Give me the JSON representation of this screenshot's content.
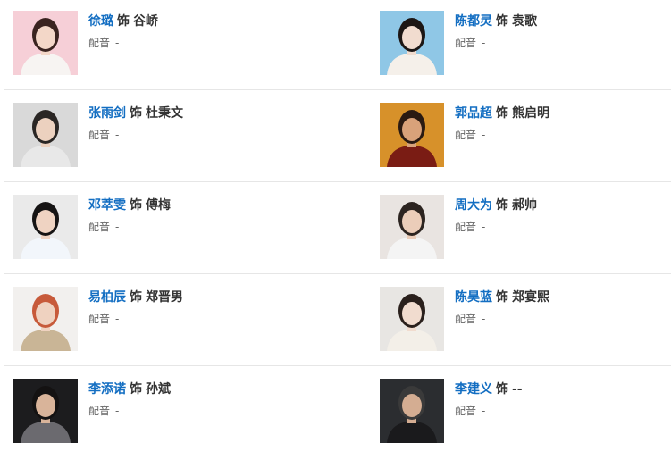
{
  "cast": [
    {
      "actor": "徐璐",
      "as_word": "饰",
      "role": "谷峤",
      "dub_label": "配音",
      "dub_value": "-",
      "photo": {
        "bg": "#f6cfd7",
        "hair": "#3a2420",
        "skin": "#f3d7c8",
        "cloth": "#f7f4f2"
      }
    },
    {
      "actor": "陈都灵",
      "as_word": "饰",
      "role": "袁歌",
      "dub_label": "配音",
      "dub_value": "-",
      "photo": {
        "bg": "#8fc7e6",
        "hair": "#1c1614",
        "skin": "#f1dccf",
        "cloth": "#f5f0ea"
      }
    },
    {
      "actor": "张雨剑",
      "as_word": "饰",
      "role": "杜秉文",
      "dub_label": "配音",
      "dub_value": "-",
      "photo": {
        "bg": "#d9d9d9",
        "hair": "#2a2624",
        "skin": "#ecd1bf",
        "cloth": "#e8e8e8"
      }
    },
    {
      "actor": "郭品超",
      "as_word": "饰",
      "role": "熊启明",
      "dub_label": "配音",
      "dub_value": "-",
      "photo": {
        "bg": "#d7912a",
        "hair": "#2a1a12",
        "skin": "#d9a27a",
        "cloth": "#7a1c14"
      }
    },
    {
      "actor": "邓萃雯",
      "as_word": "饰",
      "role": "傅梅",
      "dub_label": "配音",
      "dub_value": "-",
      "photo": {
        "bg": "#eaeaea",
        "hair": "#161414",
        "skin": "#efd3c2",
        "cloth": "#f2f6fb"
      }
    },
    {
      "actor": "周大为",
      "as_word": "饰",
      "role": "郝帅",
      "dub_label": "配音",
      "dub_value": "-",
      "photo": {
        "bg": "#e9e4e1",
        "hair": "#2c2420",
        "skin": "#ebcdb9",
        "cloth": "#f4f4f4"
      }
    },
    {
      "actor": "易柏辰",
      "as_word": "饰",
      "role": "郑晋男",
      "dub_label": "配音",
      "dub_value": "-",
      "photo": {
        "bg": "#f2f0ee",
        "hair": "#c75a3a",
        "skin": "#efd2c0",
        "cloth": "#c9b596"
      }
    },
    {
      "actor": "陈昊蓝",
      "as_word": "饰",
      "role": "郑宴熙",
      "dub_label": "配音",
      "dub_value": "-",
      "photo": {
        "bg": "#e8e6e3",
        "hair": "#2a201c",
        "skin": "#f1dccf",
        "cloth": "#f3efe8"
      }
    },
    {
      "actor": "李添诺",
      "as_word": "饰",
      "role": "孙斌",
      "dub_label": "配音",
      "dub_value": "-",
      "photo": {
        "bg": "#1c1c1e",
        "hair": "#141212",
        "skin": "#d9b49a",
        "cloth": "#6b6a6f"
      }
    },
    {
      "actor": "李建义",
      "as_word": "饰",
      "role": "--",
      "dub_label": "配音",
      "dub_value": "-",
      "photo": {
        "bg": "#2b2d30",
        "hair": "#3a3a3a",
        "skin": "#d4ad92",
        "cloth": "#1a1a1c"
      }
    }
  ]
}
